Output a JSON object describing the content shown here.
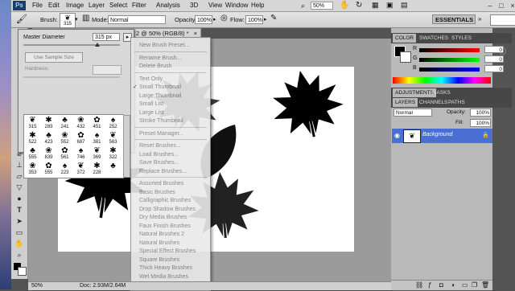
{
  "app": {
    "logo": "Ps"
  },
  "menubar": {
    "items": [
      "File",
      "Edit",
      "Image",
      "Layer",
      "Select",
      "Filter",
      "Analysis",
      "3D",
      "View",
      "Window",
      "Help"
    ],
    "zoom": "50%",
    "workspace": "ESSENTIALS",
    "window_controls": [
      "–",
      "□",
      "×"
    ]
  },
  "options": {
    "brush_label": "Brush:",
    "brush_size": "315",
    "mode_label": "Mode:",
    "mode_value": "Normal",
    "opacity_label": "Opacity:",
    "opacity_value": "100%",
    "flow_label": "Flow:",
    "flow_value": "100%"
  },
  "picker": {
    "master_label": "Master Diameter",
    "master_value": "315 px",
    "sample_button": "Use Sample Size",
    "hardness_label": "Hardness:",
    "brush_sizes": [
      [
        "315",
        "283",
        "241",
        "432",
        "451",
        "252"
      ],
      [
        "522",
        "423",
        "552",
        "687",
        "381",
        "563"
      ],
      [
        "555",
        "839",
        "561",
        "746",
        "369",
        "322"
      ],
      [
        "353",
        "555",
        "223",
        "372",
        "228",
        ""
      ]
    ]
  },
  "document": {
    "tab_title": "2 @ 50% (RGB/8) *",
    "status_zoom": "50%",
    "status_doc": "Doc: 2.93M/2.64M"
  },
  "brush_menu": {
    "items": [
      "New Brush Preset...",
      "---",
      "Rename Brush...",
      "Delete Brush",
      "---",
      "Text Only",
      "Small Thumbnail",
      "Large Thumbnail",
      "Small List",
      "Large List",
      "Stroke Thumbnail",
      "---",
      "Preset Manager...",
      "---",
      "Reset Brushes...",
      "Load Brushes...",
      "Save Brushes...",
      "Replace Brushes...",
      "---",
      "Assorted Brushes",
      "Basic Brushes",
      "Calligraphic Brushes",
      "Drop Shadow Brushes",
      "Dry Media Brushes",
      "Faux Finish Brushes",
      "Natural Brushes 2",
      "Natural Brushes",
      "Special Effect Brushes",
      "Square Brushes",
      "Thick Heavy Brushes",
      "Wet Media Brushes"
    ],
    "checked": "Small Thumbnail"
  },
  "panels": {
    "color_tabs": [
      "COLOR",
      "SWATCHES",
      "STYLES"
    ],
    "channels": [
      {
        "name": "R",
        "value": "0"
      },
      {
        "name": "G",
        "value": "0"
      },
      {
        "name": "B",
        "value": "0"
      }
    ],
    "adjust_tabs": [
      "ADJUSTMENTS",
      "MASKS"
    ],
    "layer_tabs": [
      "LAYERS",
      "CHANNELS",
      "PATHS"
    ],
    "blend_mode": "Normal",
    "opacity_label": "Opacity:",
    "opacity_value": "100%",
    "fill_label": "Fill:",
    "fill_value": "100%",
    "layer_name": "Background"
  },
  "colors": {
    "accent": "#4a6fd2",
    "menu_text": "#7f7f7f",
    "panel_bg": "#b9b9b9"
  }
}
